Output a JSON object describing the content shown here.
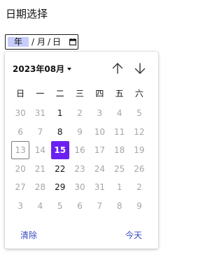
{
  "page": {
    "title": "日期选择"
  },
  "date_input": {
    "year_placeholder": "年",
    "separator": "/",
    "month_placeholder": "月",
    "day_placeholder": "日"
  },
  "calendar": {
    "month_label": "2023年08月",
    "weekdays": [
      "日",
      "一",
      "二",
      "三",
      "四",
      "五",
      "六"
    ],
    "weeks": [
      [
        "30",
        "31",
        "1",
        "2",
        "3",
        "4",
        "5"
      ],
      [
        "6",
        "7",
        "8",
        "9",
        "10",
        "11",
        "12"
      ],
      [
        "13",
        "14",
        "15",
        "16",
        "17",
        "18",
        "19"
      ],
      [
        "20",
        "21",
        "22",
        "23",
        "24",
        "25",
        "26"
      ],
      [
        "27",
        "28",
        "29",
        "30",
        "31",
        "1",
        "2"
      ],
      [
        "3",
        "4",
        "5",
        "6",
        "7",
        "8",
        "9"
      ]
    ],
    "emphasized_column": 2,
    "current_day": "13",
    "selected_day": "15",
    "clear_label": "清除",
    "today_label": "今天"
  },
  "colors": {
    "selected_bg": "#6b20f0",
    "year_segment_highlight": "#c6cdfa",
    "link": "#3949c4",
    "muted_text": "#a6a6a6"
  },
  "icons": {
    "input": "calendar-icon",
    "prev": "arrow-up-icon",
    "next": "arrow-down-icon",
    "month_dropdown": "caret-down-icon"
  }
}
